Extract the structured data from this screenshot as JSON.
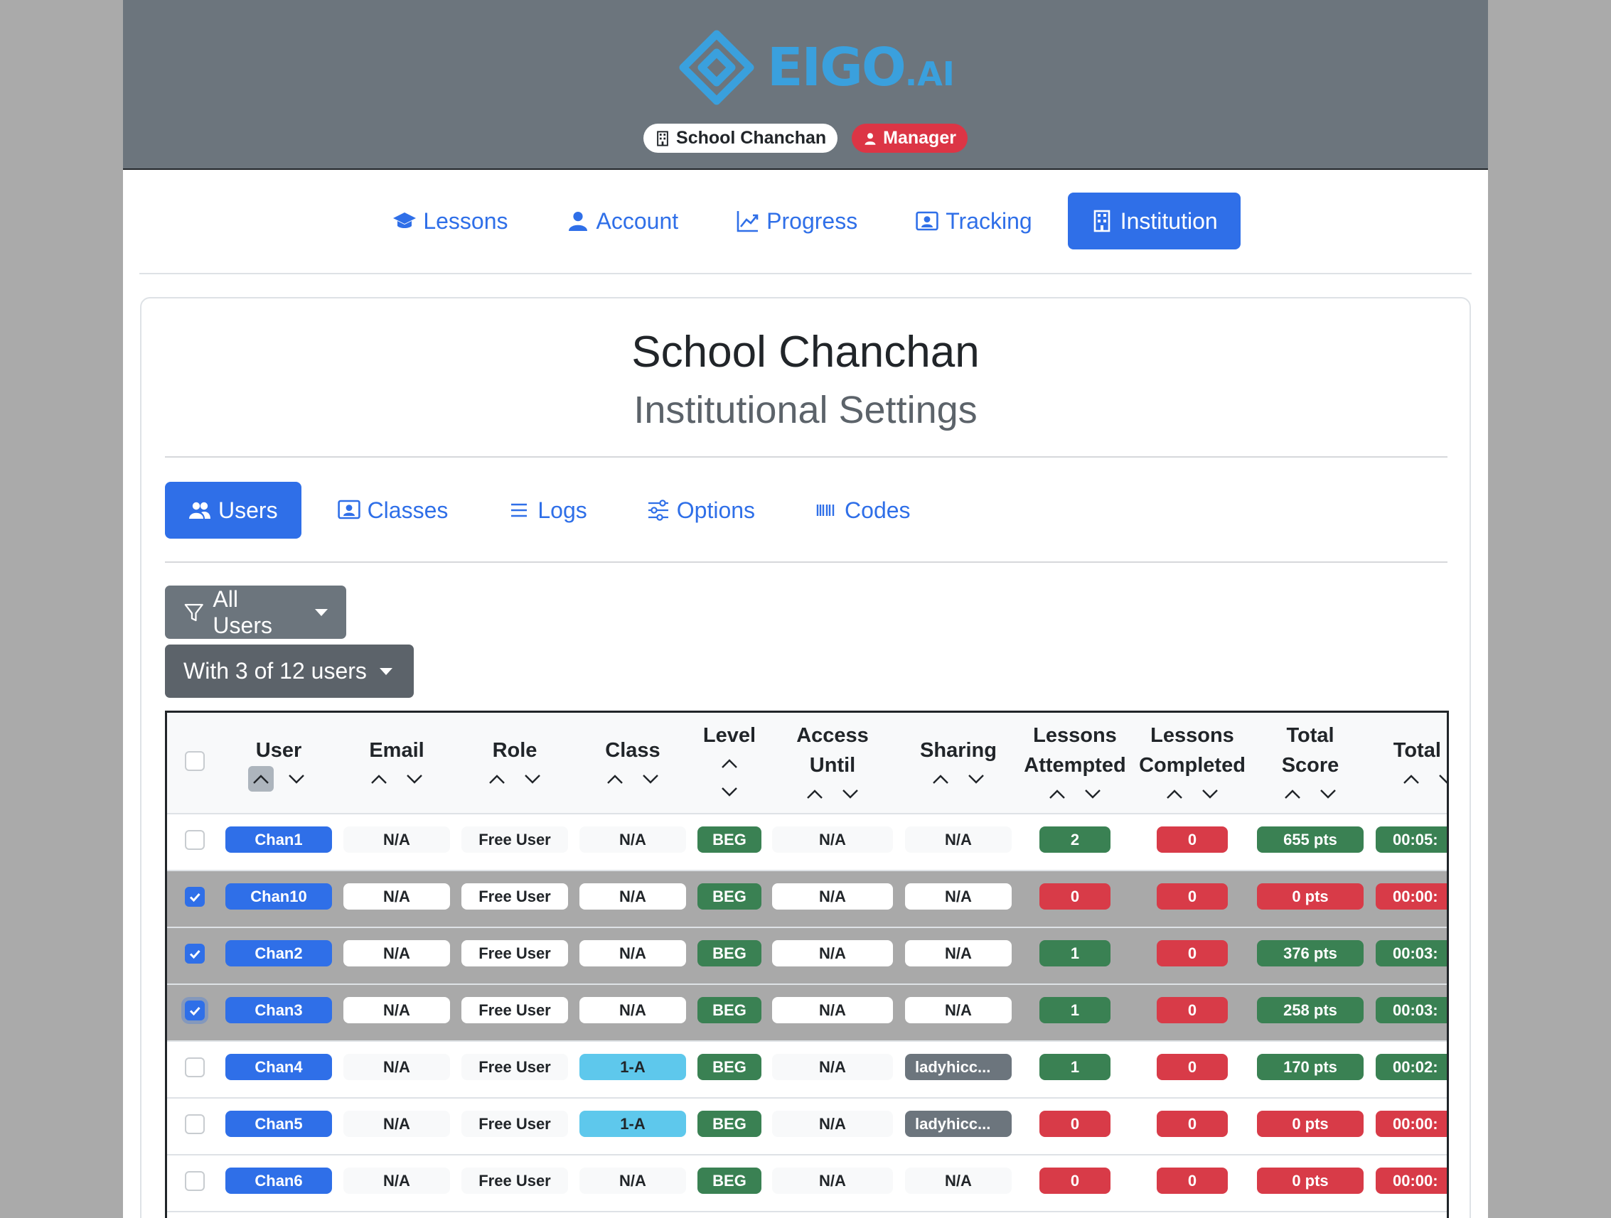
{
  "brand": {
    "logo_text": "EIGO",
    "logo_suffix": ".AI",
    "institution_badge": "School Chanchan",
    "role_badge": "Manager",
    "logo_color": "#3aa0dd"
  },
  "main_nav": [
    {
      "label": "Lessons",
      "icon": "graduation-cap-icon",
      "active": false
    },
    {
      "label": "Account",
      "icon": "person-icon",
      "active": false
    },
    {
      "label": "Progress",
      "icon": "graph-up-icon",
      "active": false
    },
    {
      "label": "Tracking",
      "icon": "person-badge-icon",
      "active": false
    },
    {
      "label": "Institution",
      "icon": "building-icon",
      "active": true
    }
  ],
  "card": {
    "title": "School Chanchan",
    "subtitle": "Institutional Settings"
  },
  "sub_nav": [
    {
      "label": "Users",
      "icon": "people-icon",
      "active": true
    },
    {
      "label": "Classes",
      "icon": "person-video-icon",
      "active": false
    },
    {
      "label": "Logs",
      "icon": "list-icon",
      "active": false
    },
    {
      "label": "Options",
      "icon": "sliders-icon",
      "active": false
    },
    {
      "label": "Codes",
      "icon": "barcode-icon",
      "active": false
    }
  ],
  "filters": {
    "user_filter": "All Users",
    "selection_menu": "With 3 of 12 users"
  },
  "table": {
    "headers": [
      {
        "key": "user",
        "lines": [
          "User"
        ]
      },
      {
        "key": "email",
        "lines": [
          "Email"
        ]
      },
      {
        "key": "role",
        "lines": [
          "Role"
        ]
      },
      {
        "key": "class",
        "lines": [
          "Class"
        ]
      },
      {
        "key": "level",
        "lines": [
          "Level"
        ]
      },
      {
        "key": "access",
        "lines": [
          "Access",
          "Until"
        ]
      },
      {
        "key": "sharing",
        "lines": [
          "Sharing"
        ]
      },
      {
        "key": "attempted",
        "lines": [
          "Lessons",
          "Attempted"
        ]
      },
      {
        "key": "completed",
        "lines": [
          "Lessons",
          "Completed"
        ]
      },
      {
        "key": "score",
        "lines": [
          "Total",
          "Score"
        ]
      },
      {
        "key": "time",
        "lines": [
          "Total Ti"
        ]
      }
    ],
    "rows": [
      {
        "checked": false,
        "user": "Chan1",
        "email": "N/A",
        "role": "Free User",
        "class": "N/A",
        "level": "BEG",
        "access": "N/A",
        "sharing": "N/A",
        "attempted": "2",
        "completed": "0",
        "score": "655 pts",
        "time": "00:05:"
      },
      {
        "checked": true,
        "user": "Chan10",
        "email": "N/A",
        "role": "Free User",
        "class": "N/A",
        "level": "BEG",
        "access": "N/A",
        "sharing": "N/A",
        "attempted": "0",
        "completed": "0",
        "score": "0 pts",
        "time": "00:00:"
      },
      {
        "checked": true,
        "user": "Chan2",
        "email": "N/A",
        "role": "Free User",
        "class": "N/A",
        "level": "BEG",
        "access": "N/A",
        "sharing": "N/A",
        "attempted": "1",
        "completed": "0",
        "score": "376 pts",
        "time": "00:03:"
      },
      {
        "checked": true,
        "user": "Chan3",
        "email": "N/A",
        "role": "Free User",
        "class": "N/A",
        "level": "BEG",
        "access": "N/A",
        "sharing": "N/A",
        "attempted": "1",
        "completed": "0",
        "score": "258 pts",
        "time": "00:03:"
      },
      {
        "checked": false,
        "user": "Chan4",
        "email": "N/A",
        "role": "Free User",
        "class": "1-A",
        "level": "BEG",
        "access": "N/A",
        "sharing": "ladyhicc...",
        "attempted": "1",
        "completed": "0",
        "score": "170 pts",
        "time": "00:02:"
      },
      {
        "checked": false,
        "user": "Chan5",
        "email": "N/A",
        "role": "Free User",
        "class": "1-A",
        "level": "BEG",
        "access": "N/A",
        "sharing": "ladyhicc...",
        "attempted": "0",
        "completed": "0",
        "score": "0 pts",
        "time": "00:00:"
      },
      {
        "checked": false,
        "user": "Chan6",
        "email": "N/A",
        "role": "Free User",
        "class": "N/A",
        "level": "BEG",
        "access": "N/A",
        "sharing": "N/A",
        "attempted": "0",
        "completed": "0",
        "score": "0 pts",
        "time": "00:00:"
      }
    ]
  },
  "colors": {
    "primary": "#2f6fe8",
    "success": "#3a8153",
    "danger": "#d83b48",
    "info": "#5ec8ec",
    "secondary": "#6c757d",
    "selected_row": "#a9a9a9"
  }
}
